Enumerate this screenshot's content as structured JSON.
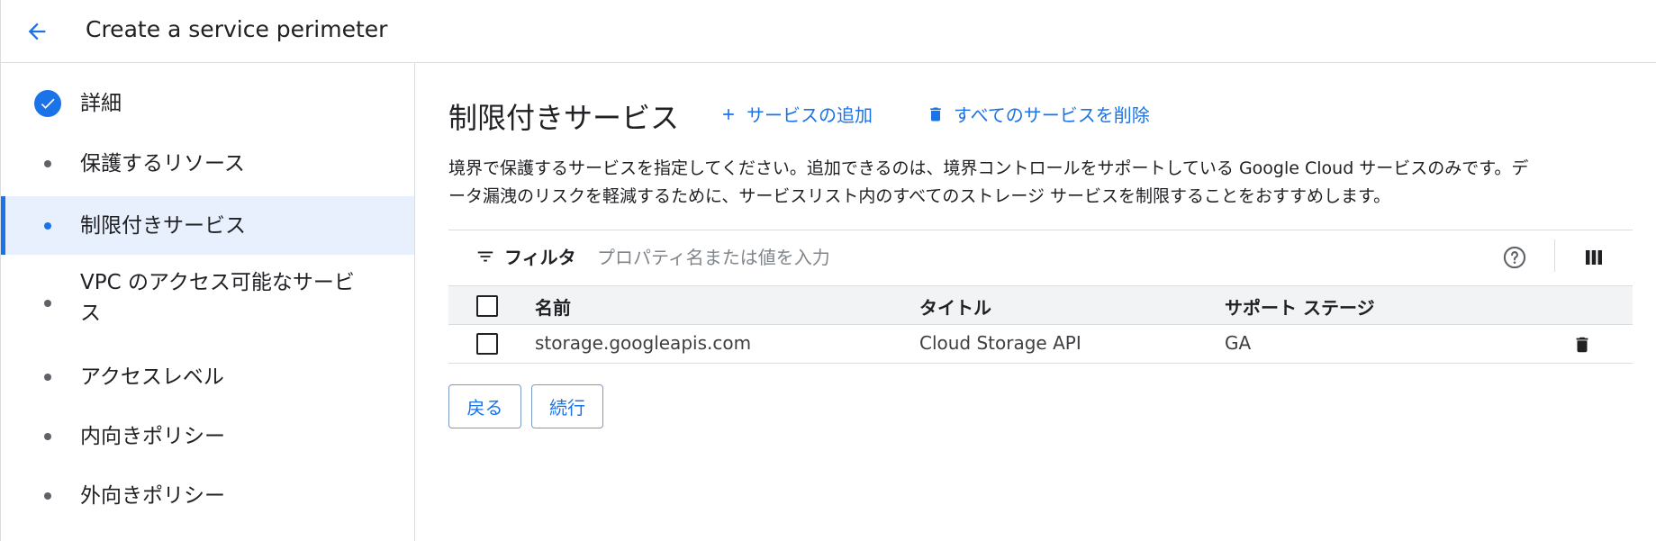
{
  "header": {
    "title": "Create a service perimeter"
  },
  "sidebar": {
    "steps": [
      {
        "label": "詳細",
        "state": "completed"
      },
      {
        "label": "保護するリソース",
        "state": "pending"
      },
      {
        "label": "制限付きサービス",
        "state": "active"
      },
      {
        "label_line1": "VPC のアクセス可能なサービ",
        "label_line2": "ス",
        "state": "pending"
      },
      {
        "label": "アクセスレベル",
        "state": "pending"
      },
      {
        "label": "内向きポリシー",
        "state": "pending"
      },
      {
        "label": "外向きポリシー",
        "state": "pending"
      }
    ]
  },
  "main": {
    "title": "制限付きサービス",
    "add_service_label": "サービスの追加",
    "delete_all_label": "すべてのサービスを削除",
    "description_line1": "境界で保護するサービスを指定してください。追加できるのは、境界コントロールをサポートしている Google Cloud サービスのみです。デ",
    "description_line2": "ータ漏洩のリスクを軽減するために、サービスリスト内のすべてのストレージ サービスを制限することをおすすめします。",
    "filter": {
      "label": "フィルタ",
      "placeholder": "プロパティ名または値を入力"
    },
    "table": {
      "columns": [
        "名前",
        "タイトル",
        "サポート ステージ"
      ],
      "rows": [
        {
          "name": "storage.googleapis.com",
          "title": "Cloud Storage API",
          "stage": "GA"
        }
      ]
    },
    "back_label": "戻る",
    "continue_label": "続行"
  },
  "colors": {
    "accent": "#1a73e8",
    "active_bg": "#e8f0fe",
    "divider": "#dadce0"
  }
}
